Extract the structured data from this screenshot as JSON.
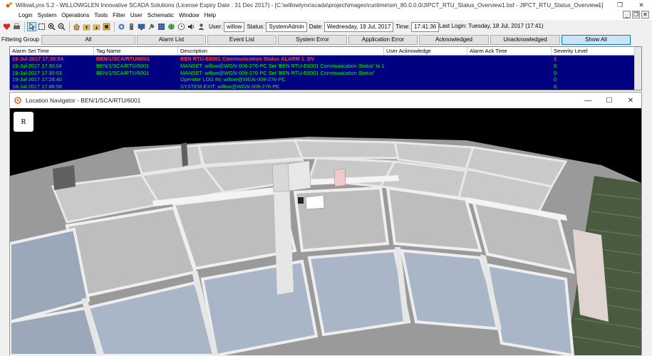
{
  "window": {
    "title": "WillowLynx 5.2 - WILLOWGLEN Innovative SCADA Solutions (License Expiry Date : 31 Dec 2017) - [C:\\willowlynx\\scada\\project\\images\\runtime\\sm_80.0.0.0/JIPCT_RTU_Status_Overview1.bsf - JIPCT_RTU_Status_Overview1]",
    "minimize": "–",
    "restore": "❐",
    "close": "✕"
  },
  "menu": [
    "Login",
    "System",
    "Operations",
    "Tools",
    "Filter",
    "User",
    "Schematic",
    "Window",
    "Help"
  ],
  "mdi_controls": [
    "_",
    "❐",
    "✕"
  ],
  "toolbar": {
    "user_label": "User:",
    "user_value": "willow",
    "status_label": "Status:",
    "status_value": "SystemAdmin",
    "date_label": "Date:",
    "date_value": "Wednesday, 19 Jul, 2017",
    "time_label": "Time:",
    "time_value": "17:41:36",
    "last_login": "Last Login: Tuesday, 18 Jul, 2017 (17:41)"
  },
  "filter": {
    "label": "Filtering Group",
    "buttons": [
      "All",
      "Alarm List",
      "Event List",
      "System Error",
      "Application Error",
      "Acknowledged",
      "Unacknowledged",
      "Show All"
    ]
  },
  "grid": {
    "headers": [
      "Alarm Set Time",
      "Tag Name",
      "Description",
      "User Acknowledge",
      "Alarm Ack Time",
      "Severity Level"
    ],
    "rows": [
      [
        "19-Jul-2017 17:30:04",
        "BEN/1/SCA/RTU/6001",
        "BEN RTU-E6001 Communication Status ALARM 1_DV",
        "",
        "",
        "1"
      ],
      [
        "19-Jul-2017 17:30:04",
        "BEN/1/SCA/RTU/6001",
        "MANSET: willow@WGN-009-276-PC Set 'BEN RTU-E6001 Communication Status' to 1",
        "",
        "",
        "0"
      ],
      [
        "19-Jul-2017 17:30:03",
        "BEN/1/SCA/RTU/6001",
        "MANSET: willow@WGN-009-276-PC Set 'BEN RTU-E6001 Communication Status'",
        "",
        "",
        "0"
      ],
      [
        "19-Jul-2017 17:28:40",
        "",
        "Operator LOG IN: willow@WGN-009-276-PC",
        "",
        "",
        "0"
      ],
      [
        "18-Jul-2017 17:48:58",
        "",
        "SYSTEM EXIT: willow@WGN-009-276-PC",
        "",
        "",
        "0"
      ]
    ]
  },
  "navigator": {
    "title": "Location Navigator - BEN/1/SCA/RTU/6001",
    "reset_button": "R",
    "minimize": "—",
    "maximize": "☐",
    "close": "✕"
  },
  "colors": {
    "grid_background": "#000080",
    "alarm_text": "#ff4040",
    "event_text": "#00ff00"
  }
}
